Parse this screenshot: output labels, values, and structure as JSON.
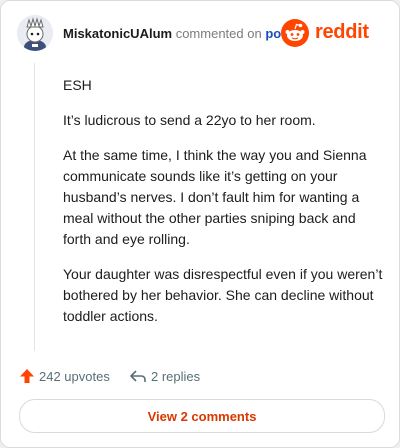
{
  "header": {
    "username": "MiskatonicUAlum",
    "commented_on": "commented on",
    "post_link": "post",
    "brand": "reddit"
  },
  "comment": {
    "paragraphs": [
      "ESH",
      "It’s ludicrous to send a 22yo to her room.",
      "At the same time, I think the way you and Sienna communicate sounds like it’s getting on your husband’s nerves. I don’t fault him for wanting a meal without the other parties sniping back and forth and eye rolling.",
      "Your daughter was disrespectful even if you weren’t bothered by her behavior. She can decline without toddler actions."
    ]
  },
  "actions": {
    "upvotes": "242 upvotes",
    "replies": "2 replies"
  },
  "view_button": "View 2 comments",
  "colors": {
    "accent": "#ff4500",
    "link": "#1b4fc1",
    "button_text": "#d93900"
  },
  "icons": {
    "upvote": "upvote-arrow-icon",
    "reply": "reply-arrow-icon",
    "brand": "reddit-snoo-icon"
  }
}
